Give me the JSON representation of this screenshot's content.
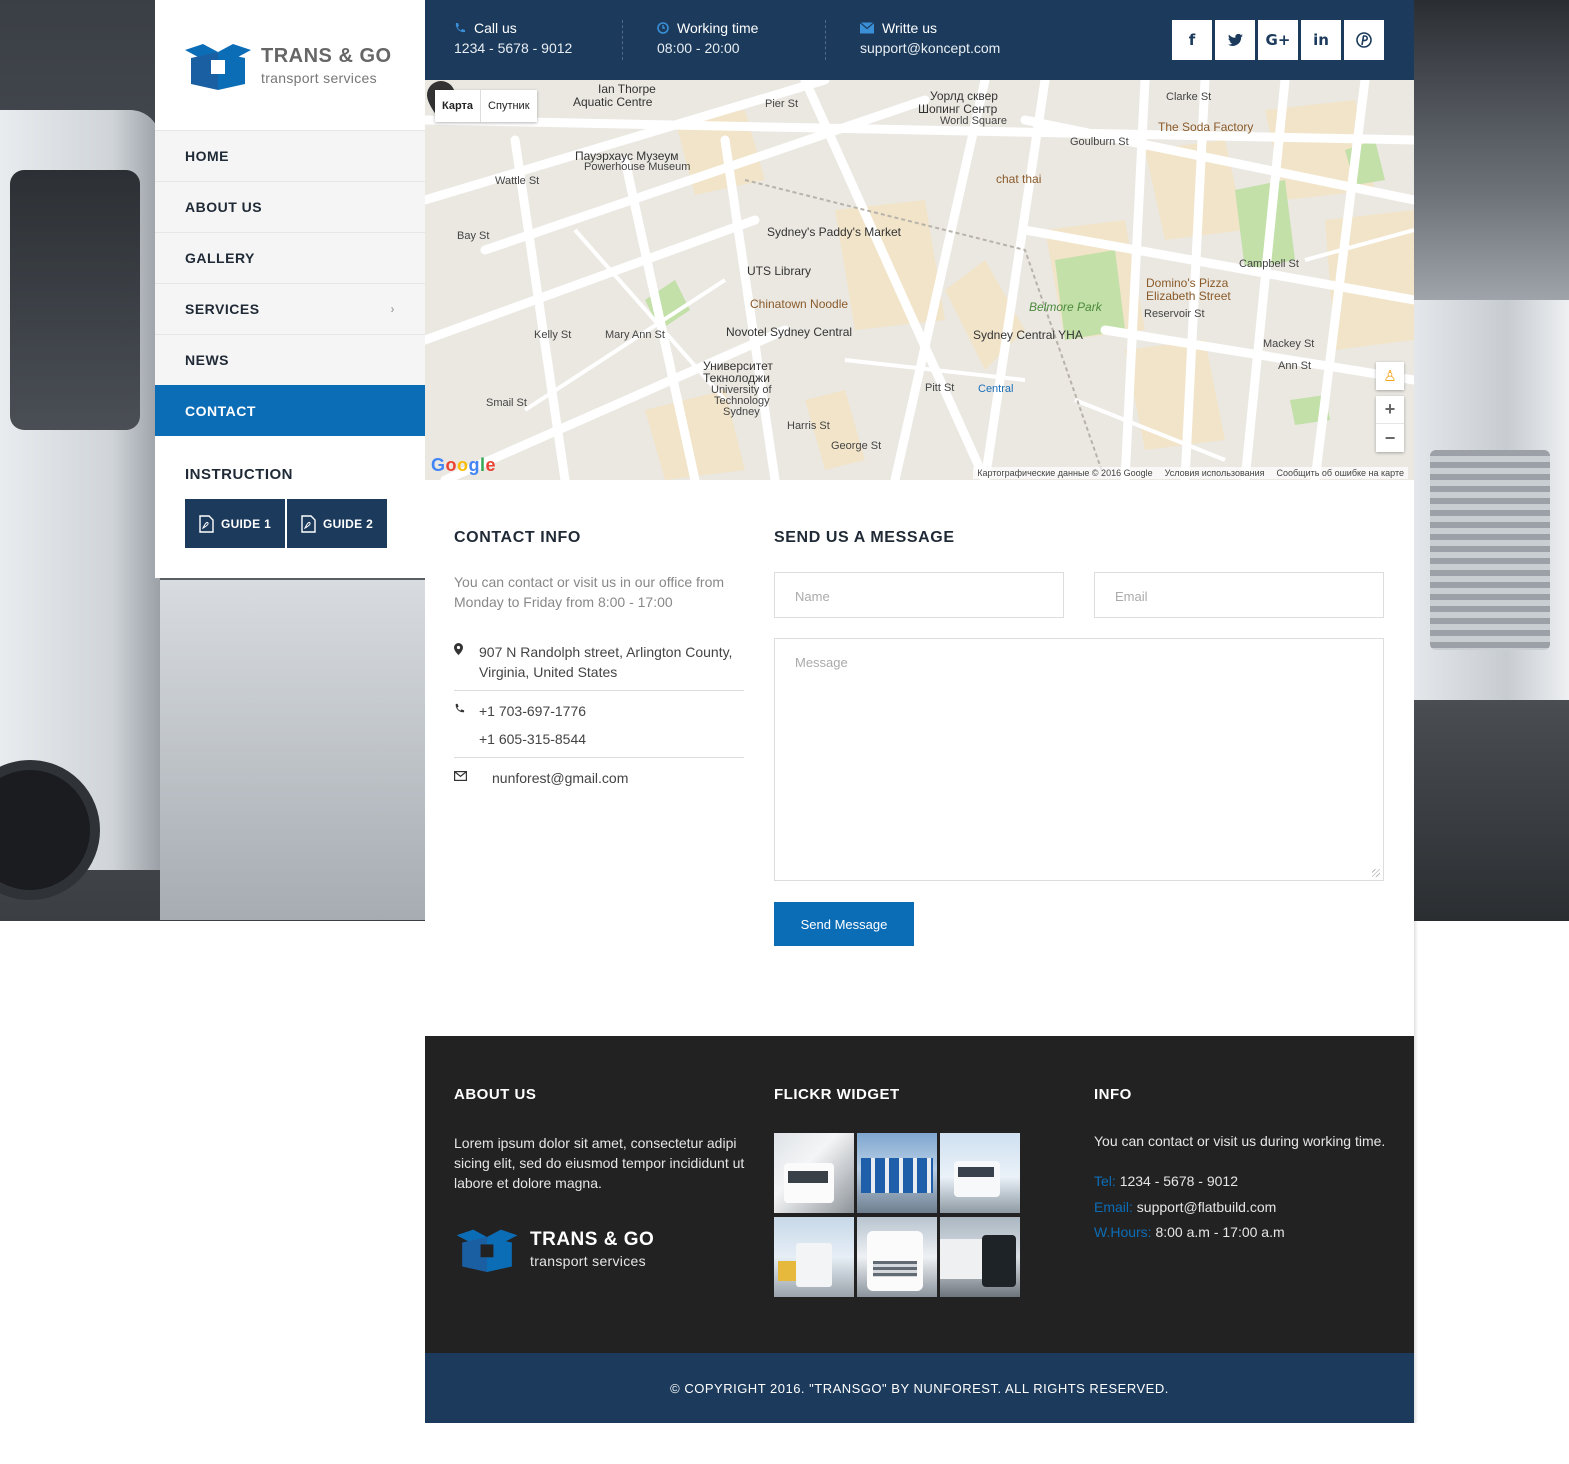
{
  "brand": {
    "title": "TRANS & GO",
    "subtitle": "transport services",
    "accent": "#0c6db7",
    "navy": "#1b3a5c"
  },
  "nav": {
    "items": [
      {
        "label": "HOME"
      },
      {
        "label": "ABOUT US"
      },
      {
        "label": "GALLERY"
      },
      {
        "label": "SERVICES",
        "chevron": "›"
      },
      {
        "label": "NEWS"
      },
      {
        "label": "CONTACT",
        "active": true
      }
    ]
  },
  "instruction": {
    "title": "INSTRUCTION",
    "guides": [
      {
        "label": "GUIDE 1"
      },
      {
        "label": "GUIDE 2"
      }
    ]
  },
  "topbar": {
    "call": {
      "label": "Call us",
      "value": "1234 - 5678 - 9012",
      "icon": "phone-icon"
    },
    "time": {
      "label": "Working time",
      "value": "08:00 - 20:00",
      "icon": "clock-icon"
    },
    "write": {
      "label": "Writte us",
      "value": "support@koncept.com",
      "icon": "envelope-icon"
    },
    "social": [
      {
        "name": "facebook-icon",
        "glyph": "f"
      },
      {
        "name": "twitter-icon",
        "glyph": "🐦"
      },
      {
        "name": "google-plus-icon",
        "glyph": "G+"
      },
      {
        "name": "linkedin-icon",
        "glyph": "in"
      },
      {
        "name": "pinterest-icon",
        "glyph": "℗"
      }
    ]
  },
  "map": {
    "type_map": "Карта",
    "type_satellite": "Спутник",
    "google": "Google",
    "attribution": [
      "Картографические данные © 2016 Google",
      "Условия использования",
      "Сообщить об ошибке на карте"
    ],
    "labels": [
      {
        "text": "Ian Thorpe",
        "cls": ""
      },
      {
        "text": "Aquatic Centre",
        "cls": ""
      },
      {
        "text": "Pier St",
        "cls": "small"
      },
      {
        "text": "Уорлд сквер",
        "cls": ""
      },
      {
        "text": "Шопинг Сентр",
        "cls": ""
      },
      {
        "text": "World Square",
        "cls": "small"
      },
      {
        "text": "Clarke St",
        "cls": "small"
      },
      {
        "text": "The Soda Factory",
        "cls": "brown"
      },
      {
        "text": "Goulburn St",
        "cls": "small"
      },
      {
        "text": "Пауэрхаус Музеум",
        "cls": ""
      },
      {
        "text": "Powerhouse Museum",
        "cls": "small"
      },
      {
        "text": "chat thai",
        "cls": "brown"
      },
      {
        "text": "Sydney's Paddy's Market",
        "cls": ""
      },
      {
        "text": "UTS Library",
        "cls": ""
      },
      {
        "text": "Chinatown Noodle",
        "cls": "brown"
      },
      {
        "text": "Novotel Sydney Central",
        "cls": ""
      },
      {
        "text": "Sydney Central YHA",
        "cls": ""
      },
      {
        "text": "Belmore Park",
        "cls": "green"
      },
      {
        "text": "Domino's Pizza",
        "cls": "brown"
      },
      {
        "text": "Elizabeth Street",
        "cls": "brown"
      },
      {
        "text": "Campbell St",
        "cls": "small"
      },
      {
        "text": "Reservoir St",
        "cls": "small"
      },
      {
        "text": "Mackey St",
        "cls": "small"
      },
      {
        "text": "Ann St",
        "cls": "small"
      },
      {
        "text": "Университет",
        "cls": ""
      },
      {
        "text": "Текнолоджи",
        "cls": ""
      },
      {
        "text": "University of",
        "cls": "small"
      },
      {
        "text": "Technology",
        "cls": "small"
      },
      {
        "text": "Sydney",
        "cls": "small"
      },
      {
        "text": "Kelly St",
        "cls": "small"
      },
      {
        "text": "Mary Ann St",
        "cls": "small"
      },
      {
        "text": "Smail St",
        "cls": "small"
      },
      {
        "text": "Wattle St",
        "cls": "small"
      },
      {
        "text": "Bay St",
        "cls": "small"
      },
      {
        "text": "Central",
        "cls": ""
      },
      {
        "text": "George St",
        "cls": "small"
      },
      {
        "text": "Pitt St",
        "cls": "small"
      },
      {
        "text": "Harris St",
        "cls": "small"
      }
    ]
  },
  "contact": {
    "title": "CONTACT INFO",
    "description": "You can contact or visit us in our office from Monday to Friday from 8:00 - 17:00",
    "address": "907 N Randolph street, Arlington County, Virginia, United States",
    "phone1": "+1 703-697-1776",
    "phone2": "+1 605-315-8544",
    "email": "nunforest@gmail.com"
  },
  "form": {
    "title": "SEND US A MESSAGE",
    "name_placeholder": "Name",
    "email_placeholder": "Email",
    "message_placeholder": "Message",
    "submit_label": "Send Message"
  },
  "footer": {
    "about_title": "ABOUT US",
    "about_text": "Lorem ipsum dolor sit amet, consectetur adipi sicing elit, sed do eiusmod tempor incididunt ut labore et dolore magna.",
    "flickr_title": "FLICKR WIDGET",
    "info_title": "INFO",
    "info_desc": "You can contact or visit us during working time.",
    "tel_key": "Tel:",
    "tel_value": "1234 - 5678 - 9012",
    "email_key": "Email:",
    "email_value": "support@flatbuild.com",
    "hours_key": "W.Hours:",
    "hours_value": "8:00 a.m - 17:00 a.m"
  },
  "copyright": "© COPYRIGHT 2016. \"TRANSGO\" BY NUNFOREST. ALL RIGHTS RESERVED."
}
